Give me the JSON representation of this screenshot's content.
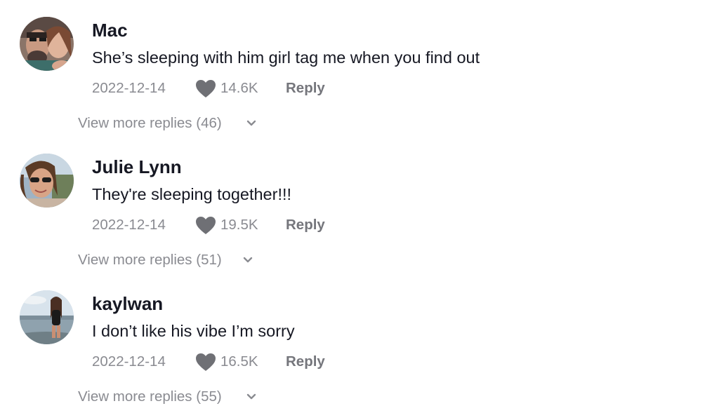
{
  "colors": {
    "text_primary": "#161823",
    "text_secondary": "#8a8b91",
    "reply": "#75767c",
    "heart": "#6f7075"
  },
  "comments": [
    {
      "username": "Mac",
      "text": "She’s sleeping with him girl tag me when you find out",
      "date": "2022-12-14",
      "likes": "14.6K",
      "reply_label": "Reply",
      "view_more": "View more replies (46)",
      "avatar_icon": "avatar-photo"
    },
    {
      "username": "Julie Lynn",
      "text": "They're sleeping together!!!",
      "date": "2022-12-14",
      "likes": "19.5K",
      "reply_label": "Reply",
      "view_more": "View more replies (51)",
      "avatar_icon": "avatar-photo"
    },
    {
      "username": "kaylwan",
      "text": "I don’t like his vibe I’m sorry",
      "date": "2022-12-14",
      "likes": "16.5K",
      "reply_label": "Reply",
      "view_more": "View more replies (55)",
      "avatar_icon": "avatar-photo"
    }
  ]
}
